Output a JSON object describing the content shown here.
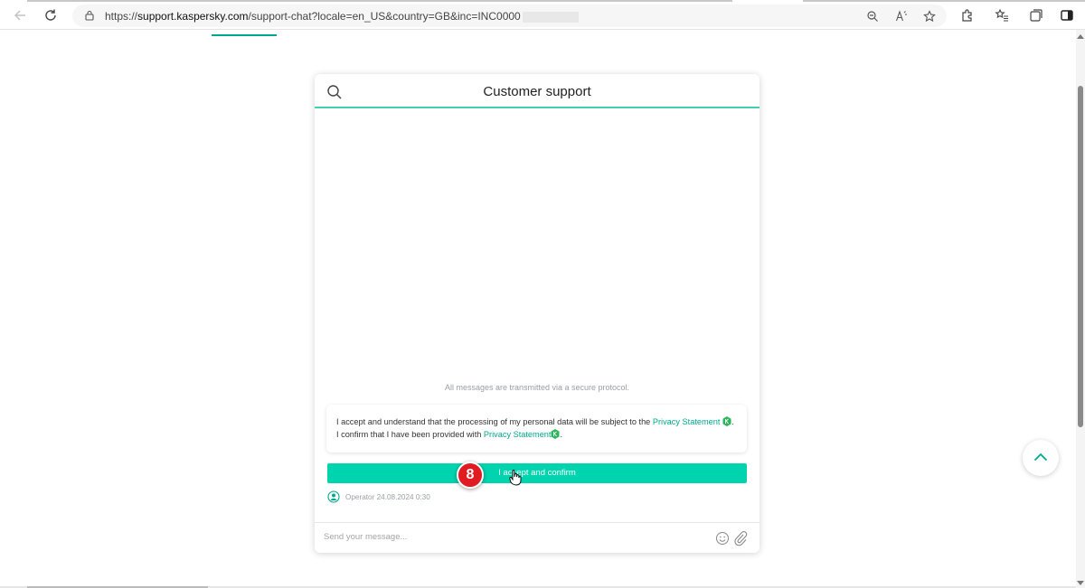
{
  "browser": {
    "url_prefix": "https://",
    "url_domain": "support.kaspersky.com",
    "url_path": "/support-chat?locale=en_US&country=GB&inc=INC0000"
  },
  "chat": {
    "title": "Customer support",
    "secure_note": "All messages are transmitted via a secure protocol.",
    "consent": {
      "text_1": "I accept and understand that the processing of my personal data will be subject to the ",
      "link_1": "Privacy Statement",
      "text_2": ". I confirm that I have been provided with ",
      "link_2": "Privacy Statement",
      "text_3": "."
    },
    "accept_button": "I accept and confirm",
    "operator_meta": "Operator 24.08.2024 0:30",
    "composer_placeholder": "Send your message..."
  },
  "step_badge": "8",
  "colors": {
    "accent": "#00d4ae",
    "link": "#00a88e",
    "badge": "#e11b22"
  },
  "icons": [
    "back-icon",
    "refresh-icon",
    "lock-icon",
    "zoom-icon",
    "read-aloud-icon",
    "favorite-icon",
    "extensions-icon",
    "favorites-bar-icon",
    "collections-icon",
    "search-icon",
    "kaspersky-k-icon",
    "operator-avatar-icon",
    "emoji-icon",
    "attach-icon",
    "chevron-up-icon",
    "hand-cursor-icon"
  ]
}
